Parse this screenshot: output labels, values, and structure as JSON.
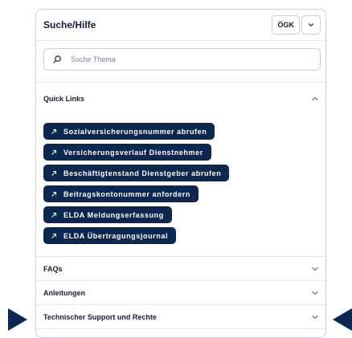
{
  "panel": {
    "title": "Suche/Hilfe",
    "provider": "ÖGK"
  },
  "search": {
    "placeholder": "Suche Thema",
    "value": ""
  },
  "quick_links": {
    "title": "Quick Links",
    "expanded": true,
    "items": [
      {
        "label": "Sozialversicherungsnummer abrufen"
      },
      {
        "label": "Versicherungsverlauf Dienstnehmer"
      },
      {
        "label": "Beschäftigtenstand Dienstgeber abrufen"
      },
      {
        "label": "Beitragskontonummer anfordern"
      },
      {
        "label": "ELDA Meldungserfassung"
      },
      {
        "label": "ELDA Übertragungsjournal"
      }
    ]
  },
  "sections": [
    {
      "title": "FAQs",
      "expanded": false
    },
    {
      "title": "Anleitungen",
      "expanded": false
    },
    {
      "title": "Technischer Support und Rechte",
      "expanded": false
    }
  ],
  "colors": {
    "accent": "#0c2750",
    "border": "#c9d0da",
    "divider": "#e3e7ed"
  },
  "icons": {
    "search": "search-icon",
    "link": "arrow-up-right-icon",
    "collapse": "chevron-up-icon",
    "expand": "chevron-down-icon"
  }
}
